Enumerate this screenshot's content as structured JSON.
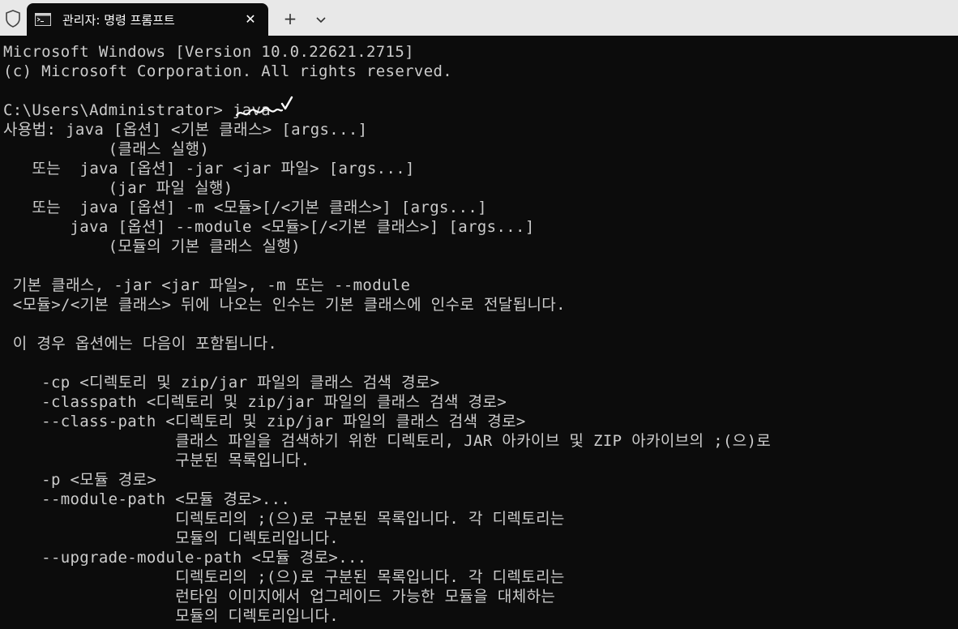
{
  "tab": {
    "title": "관리자: 명령 프롬프트",
    "close_label": "✕",
    "new_tab_label": "+"
  },
  "terminal": {
    "lines": [
      "Microsoft Windows [Version 10.0.22621.2715]",
      "(c) Microsoft Corporation. All rights reserved.",
      "",
      "C:\\Users\\Administrator> java",
      "사용법: java [옵션] <기본 클래스> [args...]",
      "           (클래스 실행)",
      "   또는  java [옵션] -jar <jar 파일> [args...]",
      "           (jar 파일 실행)",
      "   또는  java [옵션] -m <모듈>[/<기본 클래스>] [args...]",
      "       java [옵션] --module <모듈>[/<기본 클래스>] [args...]",
      "           (모듈의 기본 클래스 실행)",
      "",
      " 기본 클래스, -jar <jar 파일>, -m 또는 --module",
      " <모듈>/<기본 클래스> 뒤에 나오는 인수는 기본 클래스에 인수로 전달됩니다.",
      "",
      " 이 경우 옵션에는 다음이 포함됩니다.",
      "",
      "    -cp <디렉토리 및 zip/jar 파일의 클래스 검색 경로>",
      "    -classpath <디렉토리 및 zip/jar 파일의 클래스 검색 경로>",
      "    --class-path <디렉토리 및 zip/jar 파일의 클래스 검색 경로>",
      "                  클래스 파일을 검색하기 위한 디렉토리, JAR 아카이브 및 ZIP 아카이브의 ;(으)로",
      "                  구분된 목록입니다.",
      "    -p <모듈 경로>",
      "    --module-path <모듈 경로>...",
      "                  디렉토리의 ;(으)로 구분된 목록입니다. 각 디렉토리는",
      "                  모듈의 디렉토리입니다.",
      "    --upgrade-module-path <모듈 경로>...",
      "                  디렉토리의 ;(으)로 구분된 목록입니다. 각 디렉토리는",
      "                  런타임 이미지에서 업그레이드 가능한 모듈을 대체하는",
      "                  모듈의 디렉토리입니다."
    ]
  },
  "colors": {
    "background": "#0c0c0c",
    "foreground": "#cccccc",
    "tabbar": "#e8e8e8",
    "annotation": "#ffffff"
  },
  "icons": {
    "shield": "shield-icon",
    "console": "console-icon",
    "close": "close-icon",
    "add": "plus-icon",
    "dropdown": "chevron-down-icon",
    "annotation": "checkmark-annotation-icon"
  }
}
